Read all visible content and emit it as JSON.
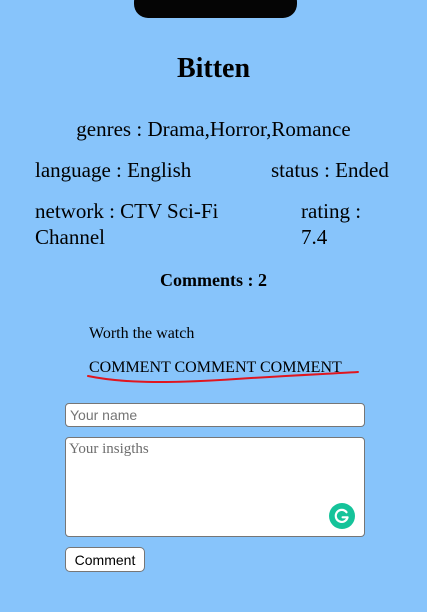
{
  "show": {
    "title": "Bitten",
    "genres": "genres : Drama,Horror,Romance",
    "language": "language : English",
    "status": "status : Ended",
    "network": "network : CTV Sci-Fi Channel",
    "rating": "rating : 7.4"
  },
  "comments": {
    "heading": "Comments : 2",
    "items": [
      {
        "text": "Worth the watch"
      },
      {
        "text": "COMMENT COMMENT COMMENT"
      }
    ]
  },
  "form": {
    "name_placeholder": "Your name",
    "insights_placeholder": "Your insigths",
    "submit_label": "Comment"
  },
  "colors": {
    "background": "#87c4fb",
    "spellcheck_underline": "#e0161f",
    "grammarly_green": "#15c39a"
  },
  "icons": {
    "grammar_assistant": "grammarly-icon"
  }
}
